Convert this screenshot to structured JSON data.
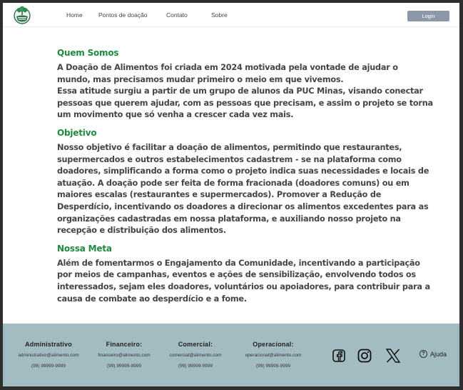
{
  "header": {
    "nav": [
      "Home",
      "Pontos de doação",
      "Contato",
      "Sobre"
    ],
    "login_label": "Login"
  },
  "sections": [
    {
      "title": "Quem Somos",
      "lines": [
        "A Doação de Alimentos foi criada em 2024 motivada pela vontade de ajudar o",
        "mundo, mas precisamos mudar primeiro o meio em que vivemos.",
        "Essa atitude surgiu a partir de um grupo de alunos da PUC Minas, visando conectar",
        "pessoas que querem ajudar, com as pessoas que precisam, e assim o projeto se torna",
        "um movimento que só venha a crescer cada vez mais."
      ]
    },
    {
      "title": "Objetivo",
      "lines": [
        "Nosso objetivo é facilitar a doação de alimentos, permitindo que restaurantes,",
        "supermercados e outros estabelecimentos cadastrem - se na plataforma como",
        "doadores, simplificando a forma como o projeto indica suas necessidades e locais de",
        "atuação. A doação pode ser feita de forma fracionada (doadores comuns) ou em",
        "maiores escalas (restaurantes e supermercados). Promover a Redução de",
        "Desperdício, incentivando os doadores a direcionar os alimentos excedentes para as",
        "organizações cadastradas em nossa plataforma, e auxiliando nosso projeto na",
        "recepção e distribuição dos alimentos."
      ]
    },
    {
      "title": "Nossa Meta",
      "lines": [
        "Além de fomentarmos o Engajamento da Comunidade, incentivando a participação",
        "por meios de campanhas, eventos e ações de sensibilização, envolvendo todos os",
        "interessados, sejam eles doadores, voluntários ou apoiadores, para contribuir para a",
        "causa de combate ao desperdício e a fome."
      ]
    }
  ],
  "footer": {
    "contacts": [
      {
        "title": "Administrativo",
        "email": "administrativo@alimento.com",
        "phone": "(99) 99999-9999"
      },
      {
        "title": "Financeiro:",
        "email": "financeiro@alimento.com",
        "phone": "(99) 99999-9999"
      },
      {
        "title": "Comercial:",
        "email": "comercial@alimento.com",
        "phone": "(99) 99999-9999"
      },
      {
        "title": "Operacional:",
        "email": "operacional@alimento.com",
        "phone": "(99) 99999-9999"
      }
    ],
    "help_label": "Ajuda"
  },
  "colors": {
    "accent_green": "#1f8a3d",
    "footer_bg": "#a3bcc1",
    "login_bg": "#8d97aa"
  }
}
